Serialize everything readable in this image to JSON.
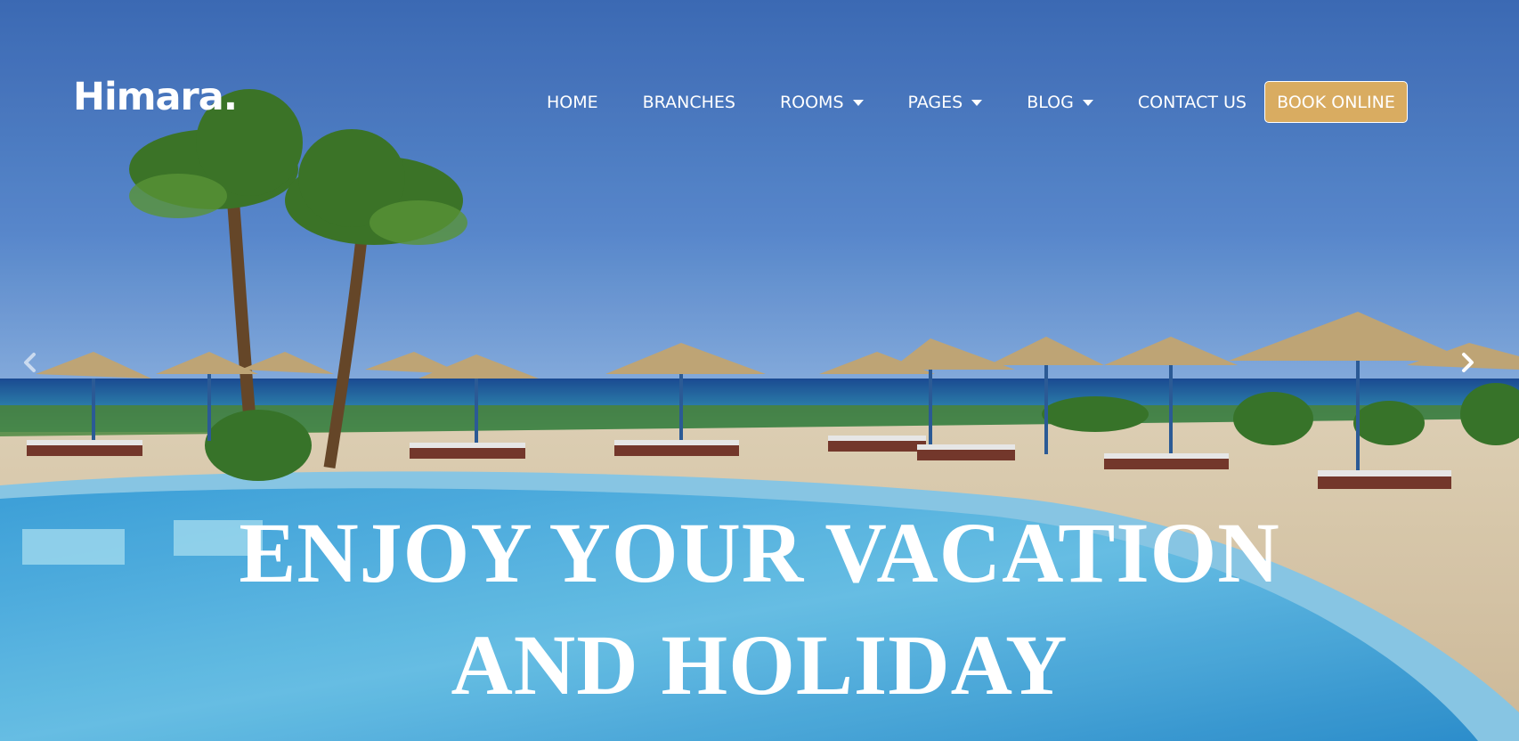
{
  "brand": {
    "logo_text": "Himara."
  },
  "nav": {
    "items": [
      {
        "label": "HOME",
        "dropdown": false
      },
      {
        "label": "BRANCHES",
        "dropdown": false
      },
      {
        "label": "ROOMS",
        "dropdown": true
      },
      {
        "label": "PAGES",
        "dropdown": true
      },
      {
        "label": "BLOG",
        "dropdown": true
      },
      {
        "label": "CONTACT US",
        "dropdown": false
      }
    ],
    "cta_label": "BOOK ONLINE"
  },
  "slider": {
    "headline_line1": "ENJOY YOUR VACATION",
    "headline_line2": "AND HOLIDAY",
    "prev_icon": "chevron-left-icon",
    "next_icon": "chevron-right-icon"
  },
  "colors": {
    "accent": "#d9ac61",
    "sky": "#4a7cc4",
    "pool": "#4fb3e8"
  }
}
